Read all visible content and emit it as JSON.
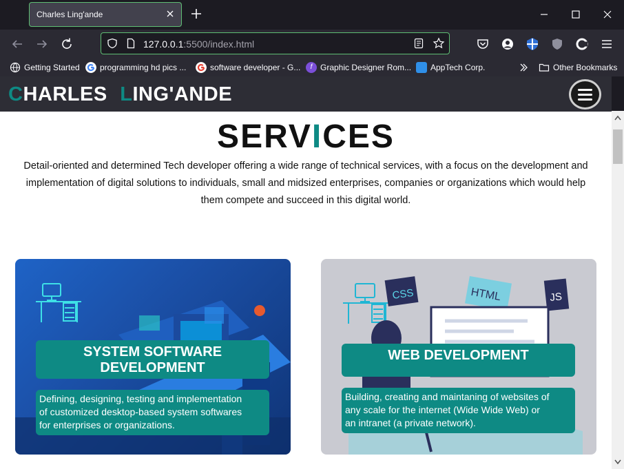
{
  "browser": {
    "tab_title": "Charles Ling'ande",
    "url_host": "127.0.0.1",
    "url_rest": ":5500/index.html"
  },
  "bookmarks": [
    {
      "label": "Getting Started",
      "icon": "globe-icon"
    },
    {
      "label": "programming hd pics ...",
      "icon": "google-icon"
    },
    {
      "label": "software developer - G...",
      "icon": "google-icon"
    },
    {
      "label": "Graphic Designer Rom...",
      "icon": "designer-icon"
    },
    {
      "label": "AppTech Corp.",
      "icon": "apptech-icon"
    }
  ],
  "other_bookmarks": "Other Bookmarks",
  "site": {
    "logo_first_initial": "C",
    "logo_first_rest": "HARLES ",
    "logo_last_initial": "L",
    "logo_last_rest": "ING'ANDE",
    "title_pre": "SERV",
    "title_accent": "I",
    "title_post": "CES",
    "intro_line1": "Detail-oriented and determined Tech developer offering a wide range of technical services, with a focus on the development and",
    "intro_line2": "implementation of digital solutions to individuals, small and midsized enterprises, companies or organizations which would help",
    "intro_line3": "them compete and succeed in this digital world.",
    "cards": [
      {
        "heading_line1": "SYSTEM SOFTWARE",
        "heading_line2": "DEVELOPMENT",
        "desc_line1": "Defining, designing, testing and implementation",
        "desc_line2": "of customized desktop-based system softwares",
        "desc_line3": "for enterprises or organizations."
      },
      {
        "heading_line1": "WEB DEVELOPMENT",
        "desc_line1": "Building, creating and maintaning of websites of",
        "desc_line2": "any scale for the internet (Wide Wide Web) or",
        "desc_line3": "an intranet (a private network).",
        "art_labels": [
          "CSS",
          "HTML",
          "JS"
        ]
      }
    ]
  },
  "colors": {
    "accent": "#0e8a84",
    "header_bg": "#2d2d35",
    "browser_bg": "#1c1b22",
    "toolbar_bg": "#2b2a33",
    "focus_green": "#5fbf74"
  }
}
